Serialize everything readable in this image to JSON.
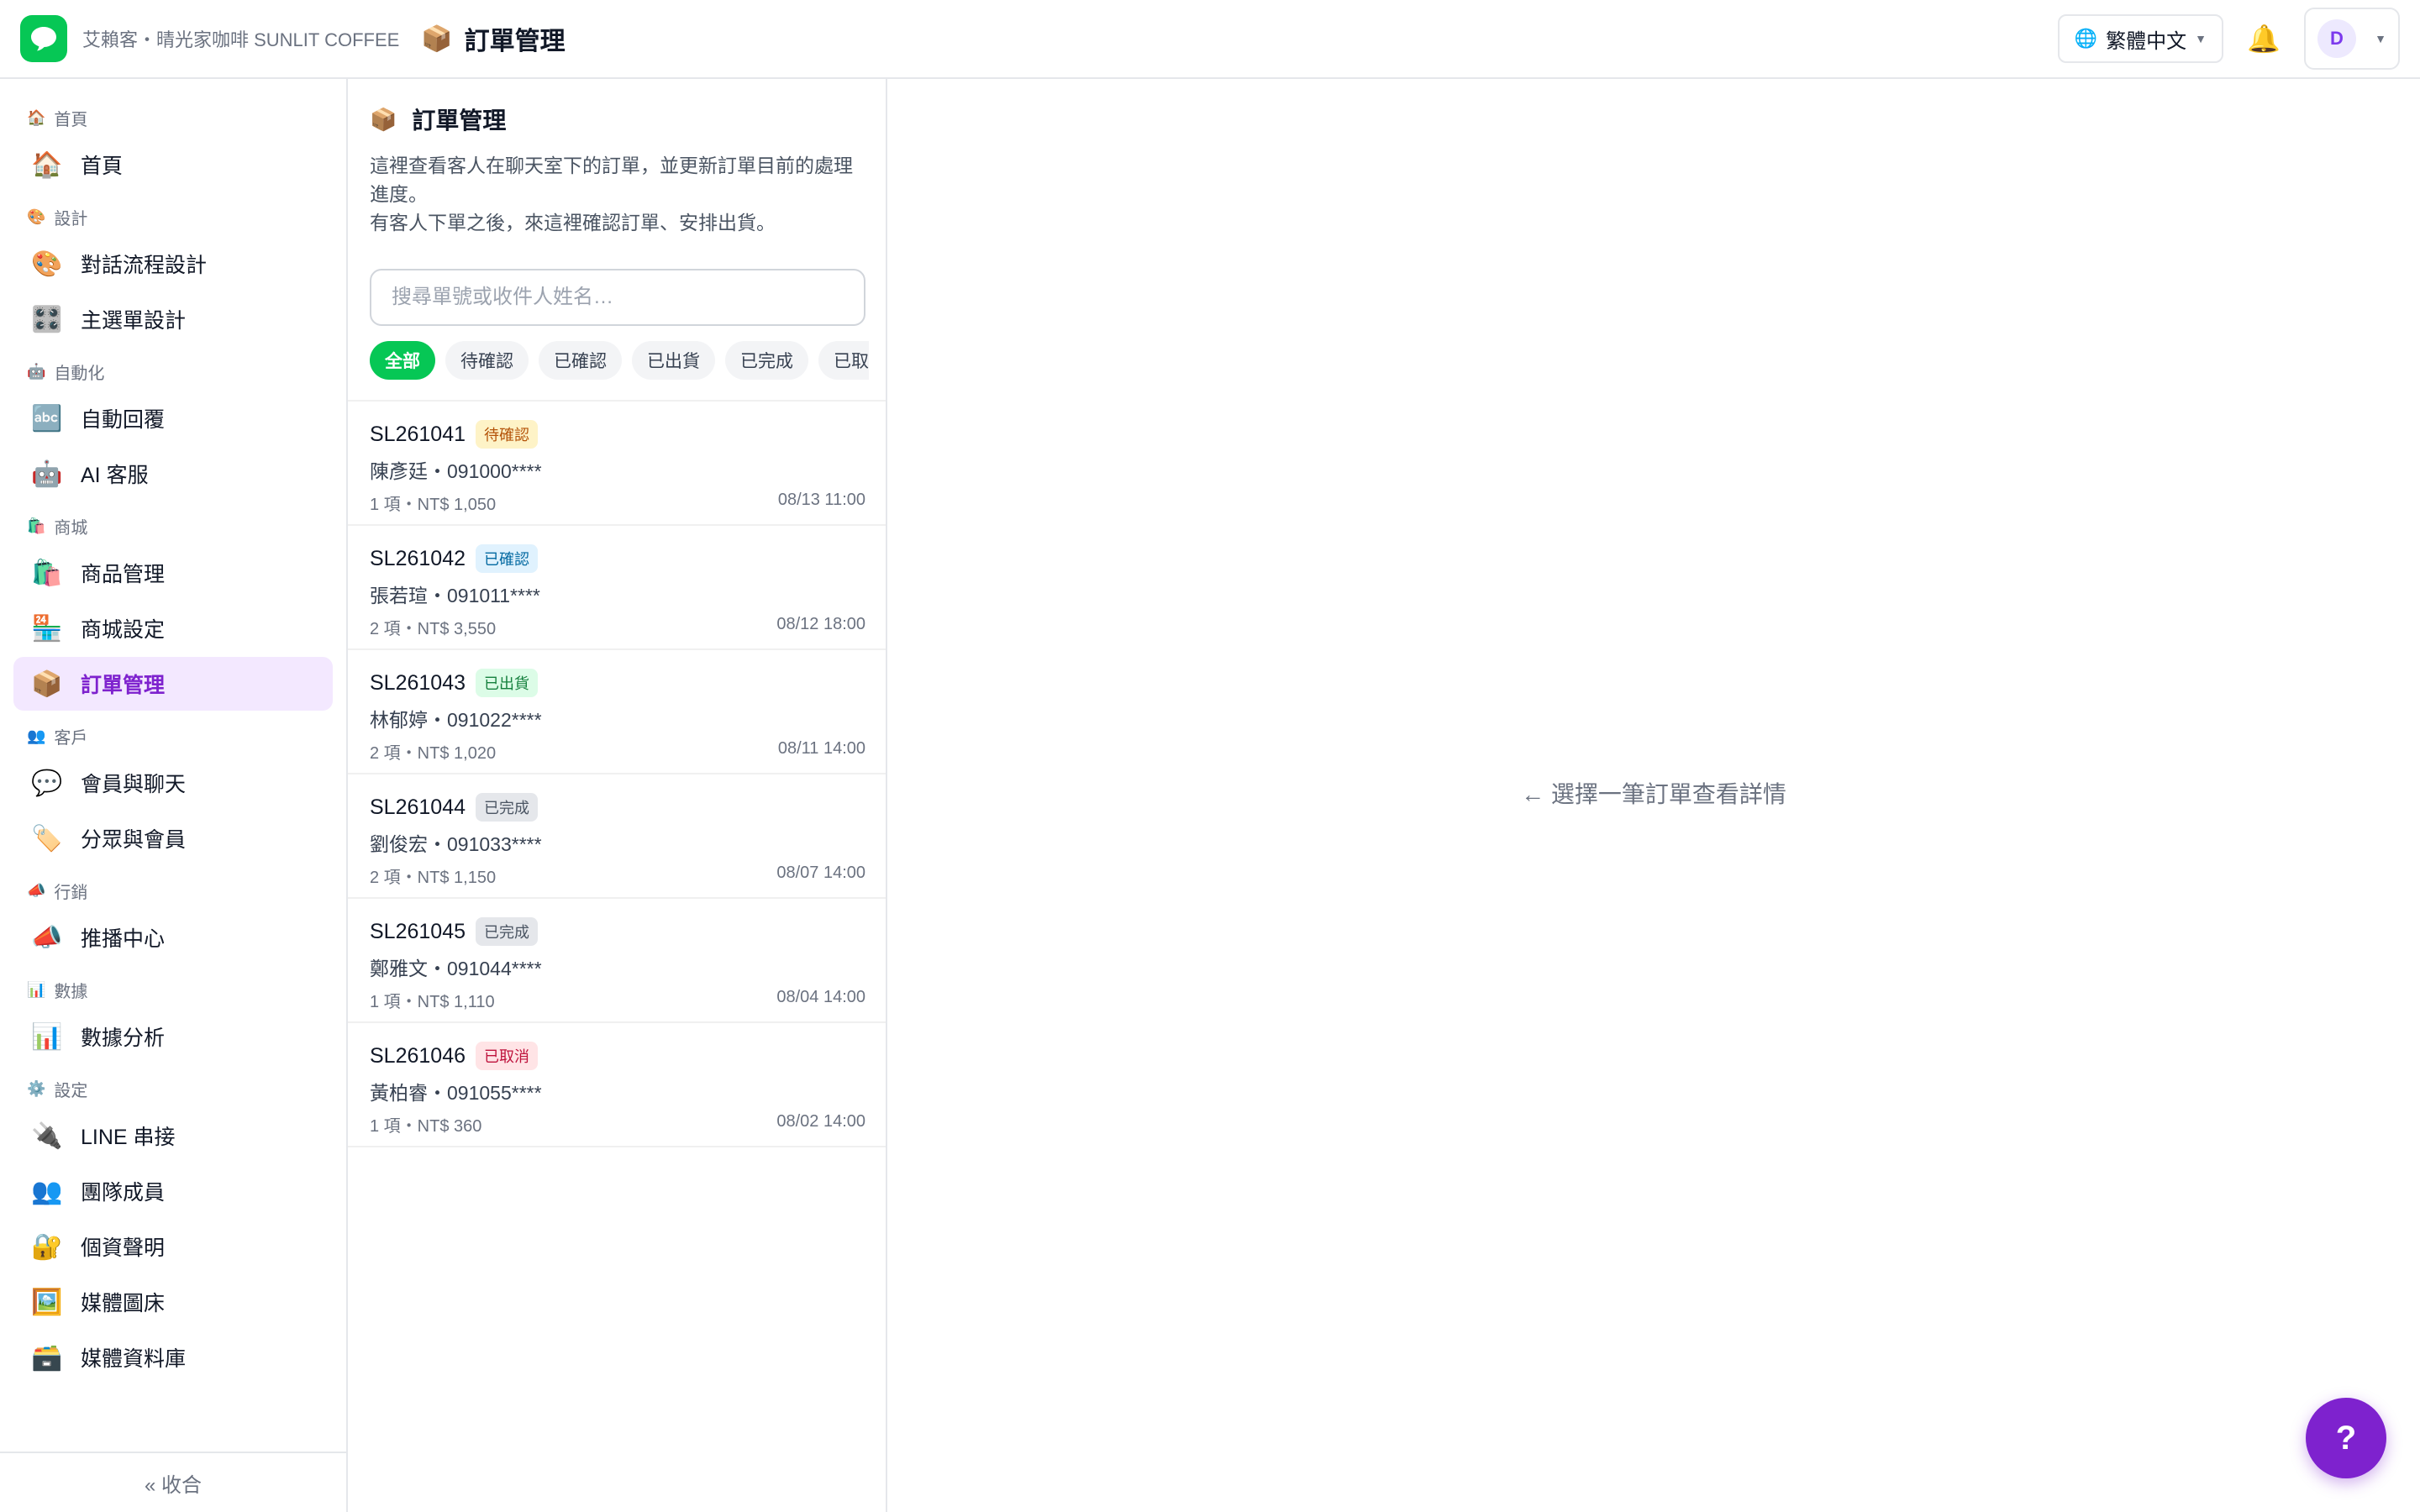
{
  "header": {
    "brand_name": "艾賴客・晴光家咖啡 SUNLIT COFFEE",
    "page_icon": "📦",
    "page_title": "訂單管理",
    "language": "繁體中文",
    "avatar_initial": "D",
    "brand_color": "#06c755",
    "accent_color": "#7e22ce"
  },
  "sidebar": {
    "groups": [
      {
        "icon": "🏠",
        "title": "首頁",
        "items": [
          {
            "icon": "🏠",
            "label": "首頁"
          }
        ]
      },
      {
        "icon": "🎨",
        "title": "設計",
        "items": [
          {
            "icon": "🎨",
            "label": "對話流程設計"
          },
          {
            "icon": "🎛️",
            "label": "主選單設計"
          }
        ]
      },
      {
        "icon": "🤖",
        "title": "自動化",
        "items": [
          {
            "icon": "🔤",
            "label": "自動回覆"
          },
          {
            "icon": "🤖",
            "label": "AI 客服"
          }
        ]
      },
      {
        "icon": "🛍️",
        "title": "商城",
        "items": [
          {
            "icon": "🛍️",
            "label": "商品管理"
          },
          {
            "icon": "🏪",
            "label": "商城設定"
          },
          {
            "icon": "📦",
            "label": "訂單管理"
          }
        ]
      },
      {
        "icon": "👥",
        "title": "客戶",
        "items": [
          {
            "icon": "💬",
            "label": "會員與聊天"
          },
          {
            "icon": "🏷️",
            "label": "分眾與會員"
          }
        ]
      },
      {
        "icon": "📣",
        "title": "行銷",
        "items": [
          {
            "icon": "📣",
            "label": "推播中心"
          }
        ]
      },
      {
        "icon": "📊",
        "title": "數據",
        "items": [
          {
            "icon": "📊",
            "label": "數據分析"
          }
        ]
      },
      {
        "icon": "⚙️",
        "title": "設定",
        "items": [
          {
            "icon": "🔌",
            "label": "LINE 串接"
          },
          {
            "icon": "👥",
            "label": "團隊成員"
          },
          {
            "icon": "🔐",
            "label": "個資聲明"
          },
          {
            "icon": "🖼️",
            "label": "媒體圖床"
          },
          {
            "icon": "🗃️",
            "label": "媒體資料庫"
          }
        ]
      }
    ],
    "active_item": "訂單管理",
    "collapse_label": "« 收合"
  },
  "orders_panel": {
    "icon": "📦",
    "title": "訂單管理",
    "description_line1": "這裡查看客人在聊天室下的訂單，並更新訂單目前的處理進度。",
    "description_line2": "有客人下單之後，來這裡確認訂單、安排出貨。",
    "search_placeholder": "搜尋單號或收件人姓名…",
    "search_value": "",
    "filters": [
      "全部",
      "待確認",
      "已確認",
      "已出貨",
      "已完成",
      "已取消"
    ],
    "active_filter": "全部",
    "orders": [
      {
        "id": "SL261041",
        "status": "待確認",
        "status_key": "pending",
        "customer": "陳彥廷・091000****",
        "summary": "1 項・NT$ 1,050",
        "time": "08/13 11:00"
      },
      {
        "id": "SL261042",
        "status": "已確認",
        "status_key": "confirmed",
        "customer": "張若瑄・091011****",
        "summary": "2 項・NT$ 3,550",
        "time": "08/12 18:00"
      },
      {
        "id": "SL261043",
        "status": "已出貨",
        "status_key": "shipped",
        "customer": "林郁婷・091022****",
        "summary": "2 項・NT$ 1,020",
        "time": "08/11 14:00"
      },
      {
        "id": "SL261044",
        "status": "已完成",
        "status_key": "done",
        "customer": "劉俊宏・091033****",
        "summary": "2 項・NT$ 1,150",
        "time": "08/07 14:00"
      },
      {
        "id": "SL261045",
        "status": "已完成",
        "status_key": "done",
        "customer": "鄭雅文・091044****",
        "summary": "1 項・NT$ 1,110",
        "time": "08/04 14:00"
      },
      {
        "id": "SL261046",
        "status": "已取消",
        "status_key": "cancelled",
        "customer": "黃柏睿・091055****",
        "summary": "1 項・NT$ 360",
        "time": "08/02 14:00"
      }
    ]
  },
  "detail": {
    "empty_hint": "← 選擇一筆訂單查看詳情"
  },
  "help": {
    "label": "?"
  }
}
